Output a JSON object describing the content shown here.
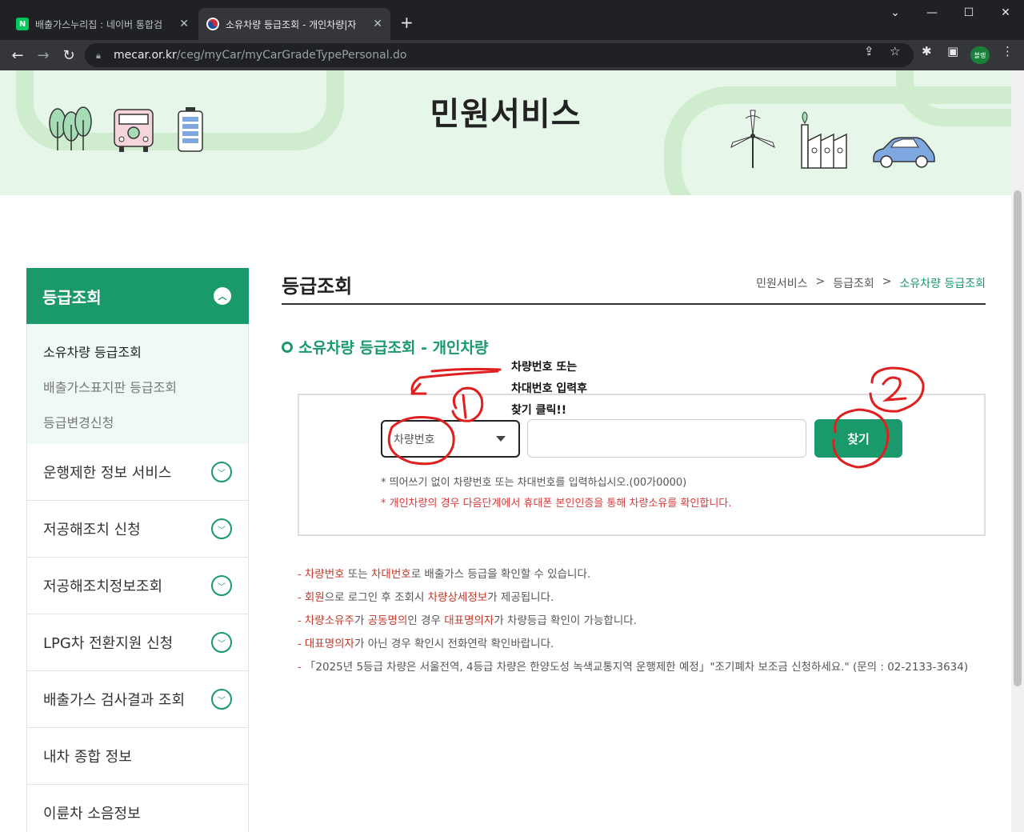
{
  "browser": {
    "tabs": [
      {
        "title": "배출가스누리집 : 네이버 통합검",
        "favicon": "N",
        "active": false
      },
      {
        "title": "소유차량 등급조회 - 개인차량|자",
        "favicon": "",
        "active": true
      }
    ],
    "url_host": "mecar.or.kr",
    "url_path": "/ceg/myCar/myCarGradeTypePersonal.do",
    "profile_label": "볼랭"
  },
  "hero": {
    "title": "민원서비스"
  },
  "sidebar": {
    "header": "등급조회",
    "subitems": [
      "소유차량 등급조회",
      "배출가스표지판 등급조회",
      "등급변경신청"
    ],
    "items": [
      "운행제한 정보 서비스",
      "저공해조치 신청",
      "저공해조치정보조회",
      "LPG차 전환지원 신청",
      "배출가스 검사결과 조회",
      "내차 종합 정보",
      "이륜차 소음정보"
    ]
  },
  "main": {
    "title": "등급조회",
    "breadcrumb": [
      "민원서비스",
      ">",
      "등급조회",
      ">",
      "소유차량 등급조회"
    ],
    "section_title": "소유차량 등급조회 - 개인차량",
    "select_value": "차량번호",
    "input_value": "",
    "find_label": "찾기",
    "hint1": "* 띄어쓰기 없이 차량번호 또는 차대번호를 입력하십시오.(00가0000)",
    "hint2": "* 개인차량의 경우 다음단계에서 휴대폰 본인인증을 통해 차량소유를 확인합니다."
  },
  "notes": [
    [
      {
        "t": "차량번호",
        "hl": true
      },
      {
        "t": " 또는 ",
        "hl": false
      },
      {
        "t": "차대번호",
        "hl": true
      },
      {
        "t": "로 배출가스 등급을 확인할 수 있습니다.",
        "hl": false
      }
    ],
    [
      {
        "t": "회원",
        "hl": true
      },
      {
        "t": "으로 로그인 후 조회시 ",
        "hl": false
      },
      {
        "t": "차량상세정보",
        "hl": true
      },
      {
        "t": "가 제공됩니다.",
        "hl": false
      }
    ],
    [
      {
        "t": "차량소유주",
        "hl": true
      },
      {
        "t": "가 ",
        "hl": false
      },
      {
        "t": "공동명의",
        "hl": true
      },
      {
        "t": "인 경우 ",
        "hl": false
      },
      {
        "t": "대표명의자",
        "hl": true
      },
      {
        "t": "가 차량등급 확인이 가능합니다.",
        "hl": false
      }
    ],
    [
      {
        "t": "대표명의자",
        "hl": true
      },
      {
        "t": "가 아닌 경우 확인시 전화연락 확인바랍니다.",
        "hl": false
      }
    ],
    [
      {
        "t": "「2025년 5등급 차량은 서울전역, 4등급 차량은 한양도성 녹색교통지역 운행제한 예정」\"조기폐차 보조금 신청하세요.\" (문의 : 02-2133-3634)",
        "hl": false
      }
    ]
  ],
  "annotation": {
    "lines": [
      "차량번호 또는",
      "차대번호 입력후",
      "찾기 클릭!!"
    ],
    "color": "#e02020"
  },
  "colors": {
    "brand": "#1a9a6a",
    "highlight": "#c0392b"
  }
}
